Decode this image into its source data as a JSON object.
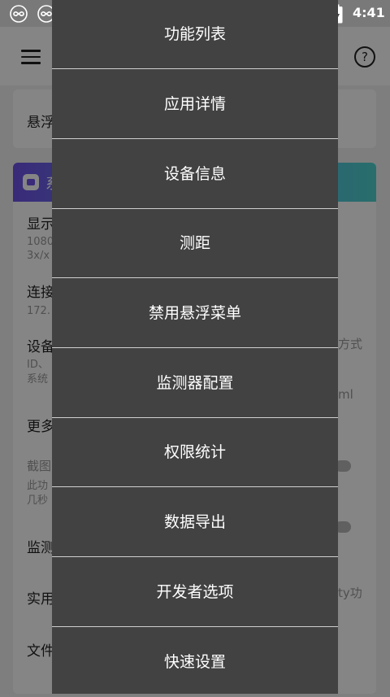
{
  "status_bar": {
    "time": "4:41",
    "icons": [
      "link-icon",
      "link-icon",
      "wifi-icon",
      "no-sim-icon",
      "battery-charging-icon"
    ]
  },
  "app_bar": {
    "help_icon": "?"
  },
  "background": {
    "card1_title": "悬浮",
    "card2_head": "系",
    "rows": [
      {
        "title": "显示",
        "sub": [
          "1080",
          "3x/x"
        ]
      },
      {
        "title": "连接",
        "sub": [
          "172."
        ]
      },
      {
        "title": "设备",
        "sub": [
          "ID、",
          "系统"
        ],
        "right": "方式",
        "right2": "ml"
      },
      {
        "title": "更多"
      },
      {
        "title": "",
        "sub": [
          "截图",
          "此功",
          "几秒"
        ]
      },
      {
        "title": "监测"
      },
      {
        "title": "实用",
        "right": "ty功"
      },
      {
        "title": "文件"
      }
    ]
  },
  "menu": {
    "items": [
      "功能列表",
      "应用详情",
      "设备信息",
      "测距",
      "禁用悬浮菜单",
      "监测器配置",
      "权限统计",
      "数据导出",
      "开发者选项",
      "快速设置"
    ]
  },
  "colors": {
    "menu_bg": "#424242",
    "divider": "#cfcfcf",
    "accent_gradient_start": "#6f52e8",
    "accent_gradient_end": "#4fd3cf"
  }
}
